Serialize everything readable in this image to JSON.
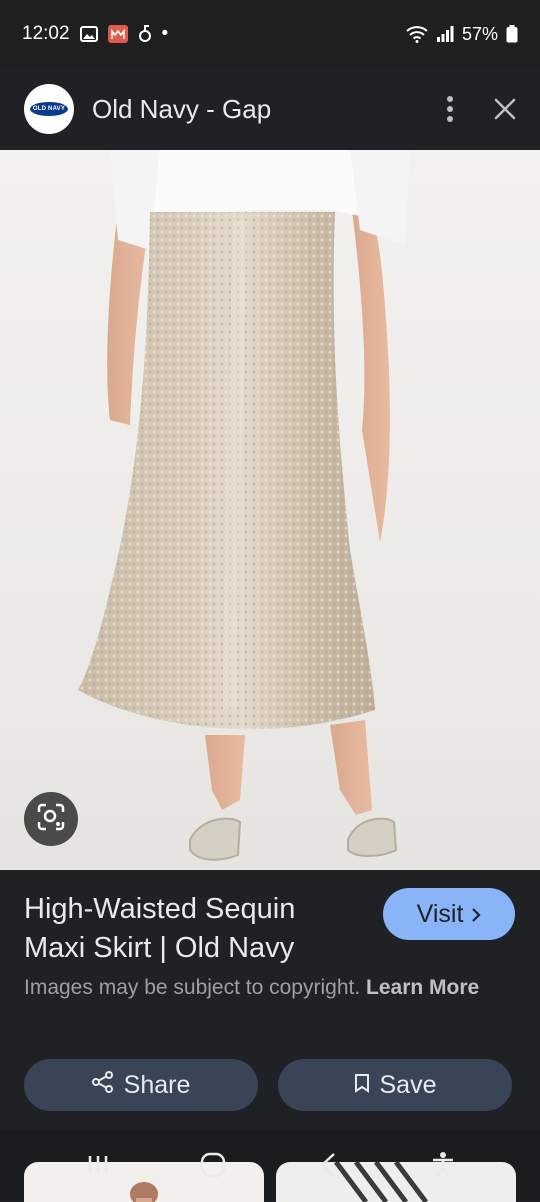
{
  "status_bar": {
    "time": "12:02",
    "battery": "57%",
    "dot": "•"
  },
  "header": {
    "logo_text": "OLD NAVY",
    "site_title": "Old Navy - Gap"
  },
  "product": {
    "title": "High-Waisted Sequin Maxi Skirt | Old Navy",
    "visit_label": "Visit",
    "copyright_text": "Images may be subject to copyright.",
    "learn_more": "Learn More"
  },
  "actions": {
    "share_label": "Share",
    "save_label": "Save"
  },
  "colors": {
    "accent": "#8ab4f8",
    "button_bg": "#394457",
    "background": "#202124"
  },
  "icons": [
    "gallery-icon",
    "app-notification-icon",
    "wifi-icon",
    "signal-icon",
    "battery-icon",
    "more-vert-icon",
    "close-icon",
    "lens-icon",
    "share-icon",
    "bookmark-icon",
    "recents-icon",
    "home-icon",
    "back-icon",
    "accessibility-icon"
  ]
}
